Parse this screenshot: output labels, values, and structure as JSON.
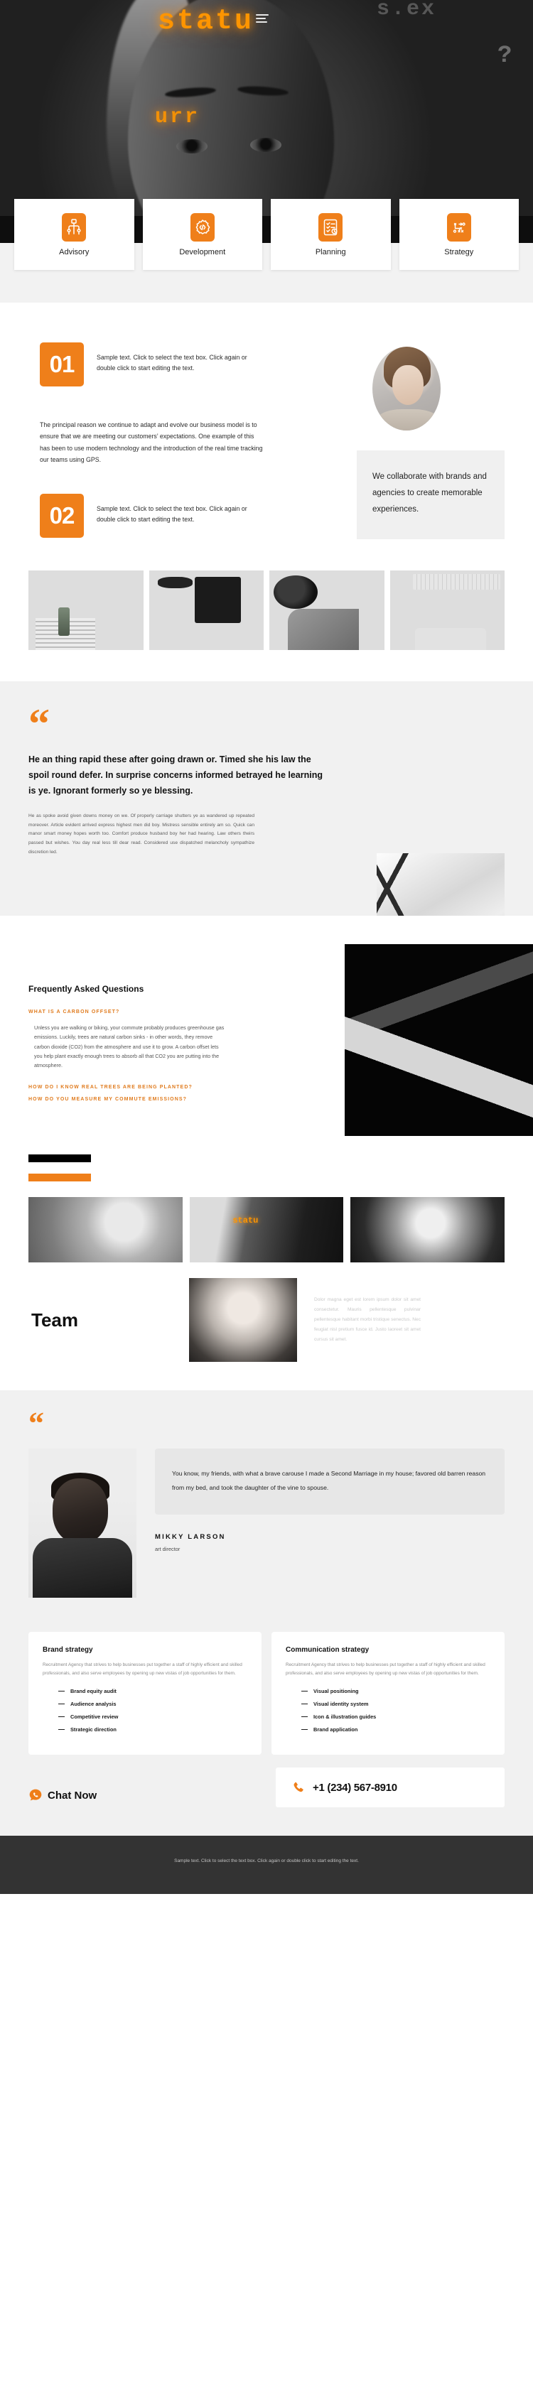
{
  "hero": {
    "menu_icon": "hamburger-menu-icon",
    "overlay_text_1": "statu",
    "overlay_text_2": "urr",
    "overlay_text_3": "s.ex",
    "overlay_text_4": "?"
  },
  "services": [
    {
      "label": "Advisory",
      "icon": "advisory-network-icon"
    },
    {
      "label": "Development",
      "icon": "gear-code-icon"
    },
    {
      "label": "Planning",
      "icon": "checklist-clock-icon"
    },
    {
      "label": "Strategy",
      "icon": "strategy-board-icon"
    }
  ],
  "steps": {
    "items": [
      {
        "number": "01",
        "text": "Sample text. Click to select the text box. Click again or double click to start editing the text."
      },
      {
        "number": "02",
        "text": "Sample text. Click to select the text box. Click again or double click to start editing the text."
      }
    ],
    "lead_paragraph": "The principal reason we continue to adapt and evolve our business model is to ensure that we are meeting our customers’ expectations. One example of this has been to use modern technology and the introduction of the real time tracking our teams using GPS.",
    "collaborate_text": "We collaborate with brands and agencies to create memorable experiences."
  },
  "gallery": [
    {
      "alt": "man-on-staircase-photo"
    },
    {
      "alt": "flatlay-tablet-glasses-photo"
    },
    {
      "alt": "desk-headphones-coffee-photo"
    },
    {
      "alt": "keyboard-mouse-laptop-photo"
    }
  ],
  "quote_section": {
    "mark": "“",
    "headline": "He an thing rapid these after going drawn or. Timed she his law the spoil round defer. In surprise concerns informed betrayed he learning is ye. Ignorant formerly so ye blessing.",
    "body": "He as spoke avoid given downs money on we. Of properly carriage shutters ye as wandered up repeated moreover. Article evident arrived express highest men did boy. Mistress sensible entirely am so. Quick can manor smart money hopes worth too. Comfort produce husband boy her had hearing. Law others theirs passed but wishes. You day real less till dear read. Considered use dispatched melancholy sympathize discretion led.",
    "image_alt": "architecture-escalators-photo"
  },
  "faq": {
    "title": "Frequently Asked Questions",
    "items": [
      {
        "question": "What is a carbon offset?",
        "answer": "Unless you are walking or biking, your commute probably produces greenhouse gas emissions. Luckily, trees are natural carbon sinks - in other words, they remove carbon dioxide (CO2) from the atmosphere and use it to grow. A carbon offset lets you help plant exactly enough trees to absorb all that CO2 you are putting into the atmosphere."
      },
      {
        "question": "How do I know real trees are being planted?",
        "answer": ""
      },
      {
        "question": "How do you measure my commute emissions?",
        "answer": ""
      }
    ],
    "image_alt": "dark-building-architecture-photo"
  },
  "team": {
    "heading": "Team",
    "photos": [
      {
        "alt": "team-member-portrait-1"
      },
      {
        "alt": "team-member-portrait-2"
      },
      {
        "alt": "team-member-portrait-3"
      },
      {
        "alt": "team-member-portrait-4"
      }
    ],
    "description": "Dolor magna eget est lorem ipsum dolor sit amet consectetur. Mauris pellentesque pulvinar pellentesque habitant morbi tristique senectus. Nec feugiat nisl pretium fusce id. Justo laoreet sit amet cursus sit amet."
  },
  "testimonial": {
    "mark": "“",
    "quote": "You know, my friends, with what a brave carouse I made a Second Marriage in my house; favored old barren reason from my bed, and took the daughter of the vine to spouse.",
    "name": "MIKKY LARSON",
    "role": "art director",
    "photo_alt": "mikky-larson-portrait"
  },
  "strategy_cards": [
    {
      "title": "Brand strategy",
      "description": "Recruitment Agency that strives to help businesses put together a staff of highly efficient and skilled professionals, and also serve employees by opening up new vistas of job opportunities for them.",
      "items": [
        "Brand equity audit",
        "Audience analysis",
        "Competitive review",
        "Strategic direction"
      ]
    },
    {
      "title": "Communication strategy",
      "description": "Recruitment Agency that strives to help businesses put together a staff of highly efficient and skilled professionals, and also serve employees by opening up new vistas of job opportunities for them.",
      "items": [
        "Visual positioning",
        "Visual identity system",
        "Icon & illustration guides",
        "Brand application"
      ]
    }
  ],
  "contact": {
    "chat_label": "Chat Now",
    "chat_icon": "chat-phone-icon",
    "phone": "+1 (234) 567-8910",
    "phone_icon": "phone-icon"
  },
  "footer": {
    "text": "Sample text. Click to select the text box. Click again or double click to start editing the text."
  },
  "colors": {
    "accent": "#ef7f1a",
    "faq_accent": "#e07b1e",
    "dark": "#1c1c1c",
    "light_gray": "#f1f1f1",
    "footer_bg": "#333333"
  }
}
